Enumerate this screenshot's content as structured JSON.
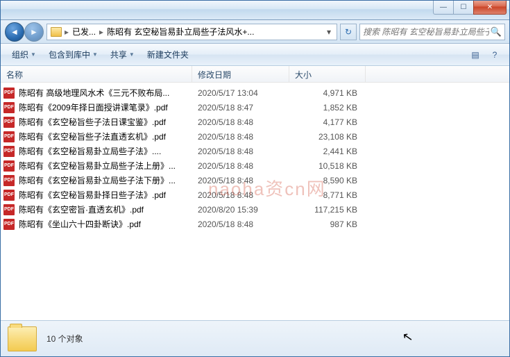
{
  "titlebar": {
    "min": "—",
    "max": "☐",
    "close": "✕"
  },
  "address": {
    "back_glyph": "◄",
    "fwd_glyph": "►",
    "crumb1": "已发...",
    "crumb2": "陈昭有 玄空秘旨易卦立局些子法风水+...",
    "sep": "▸",
    "dropdown": "▾",
    "refresh": "↻"
  },
  "search": {
    "placeholder": "搜索 陈昭有 玄空秘旨易卦立局些子...",
    "icon": "🔍"
  },
  "toolbar": {
    "organize": "组织",
    "include": "包含到库中",
    "share": "共享",
    "newfolder": "新建文件夹",
    "drop": "▼"
  },
  "columns": {
    "name": "名称",
    "date": "修改日期",
    "size": "大小"
  },
  "files": [
    {
      "name": "陈昭有 高级地理风水术《三元不败布局...",
      "date": "2020/5/17 13:04",
      "size": "4,971 KB"
    },
    {
      "name": "陈昭有《2009年择日面授讲课笔录》.pdf",
      "date": "2020/5/18 8:47",
      "size": "1,852 KB"
    },
    {
      "name": "陈昭有《玄空秘旨些子法日课宝鉴》.pdf",
      "date": "2020/5/18 8:48",
      "size": "4,177 KB"
    },
    {
      "name": "陈昭有《玄空秘旨些子法直透玄机》.pdf",
      "date": "2020/5/18 8:48",
      "size": "23,108 KB"
    },
    {
      "name": "陈昭有《玄空秘旨易卦立局些子法》....",
      "date": "2020/5/18 8:48",
      "size": "2,441 KB"
    },
    {
      "name": "陈昭有《玄空秘旨易卦立局些子法上册》...",
      "date": "2020/5/18 8:48",
      "size": "10,518 KB"
    },
    {
      "name": "陈昭有《玄空秘旨易卦立局些子法下册》...",
      "date": "2020/5/18 8:48",
      "size": "8,590 KB"
    },
    {
      "name": "陈昭有《玄空秘旨易卦择日些子法》.pdf",
      "date": "2020/5/18 8:48",
      "size": "8,771 KB"
    },
    {
      "name": "陈昭有《玄空密旨·直透玄机》.pdf",
      "date": "2020/8/20 15:39",
      "size": "117,215 KB"
    },
    {
      "name": "陈昭有《坐山六十四卦断诀》.pdf",
      "date": "2020/5/18 8:48",
      "size": "987 KB"
    }
  ],
  "status": {
    "count_label": "10 个对象"
  },
  "watermark": "naoha资cn网",
  "icons": {
    "pdf": "PDF",
    "view": "▤",
    "help": "?"
  }
}
